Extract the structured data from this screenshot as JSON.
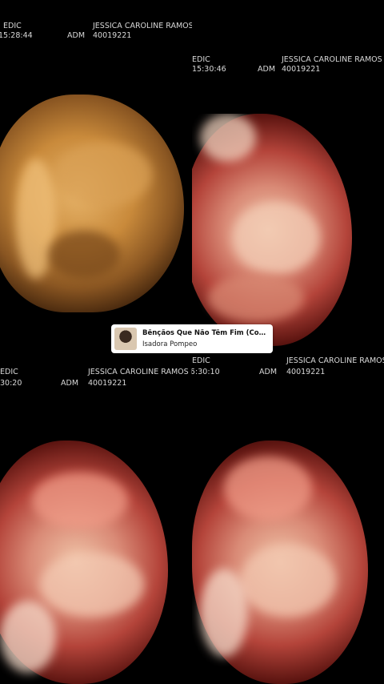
{
  "panels": [
    {
      "clinic": "EDIC",
      "time": "15:28:44",
      "operator": "ADM",
      "patient": "JESSICA CAROLINE RAMOS DI",
      "id": "40019221"
    },
    {
      "clinic": "EDIC",
      "time": "15:30:46",
      "operator": "ADM",
      "patient": "JESSICA CAROLINE RAMOS DE",
      "id": "40019221"
    },
    {
      "clinic": "EDIC",
      "time": "30:20",
      "operator": "ADM",
      "patient": "JESSICA CAROLINE RAMOS DI",
      "id": "40019221"
    },
    {
      "clinic": "EDIC",
      "time": "5:30:10",
      "operator": "ADM",
      "patient": "JESSICA CAROLINE RAMOS DE",
      "id": "40019221"
    }
  ],
  "music_sticker": {
    "title": "Bênçãos Que Não Têm Fim (Counting...",
    "artist": "Isadora Pompeo"
  }
}
